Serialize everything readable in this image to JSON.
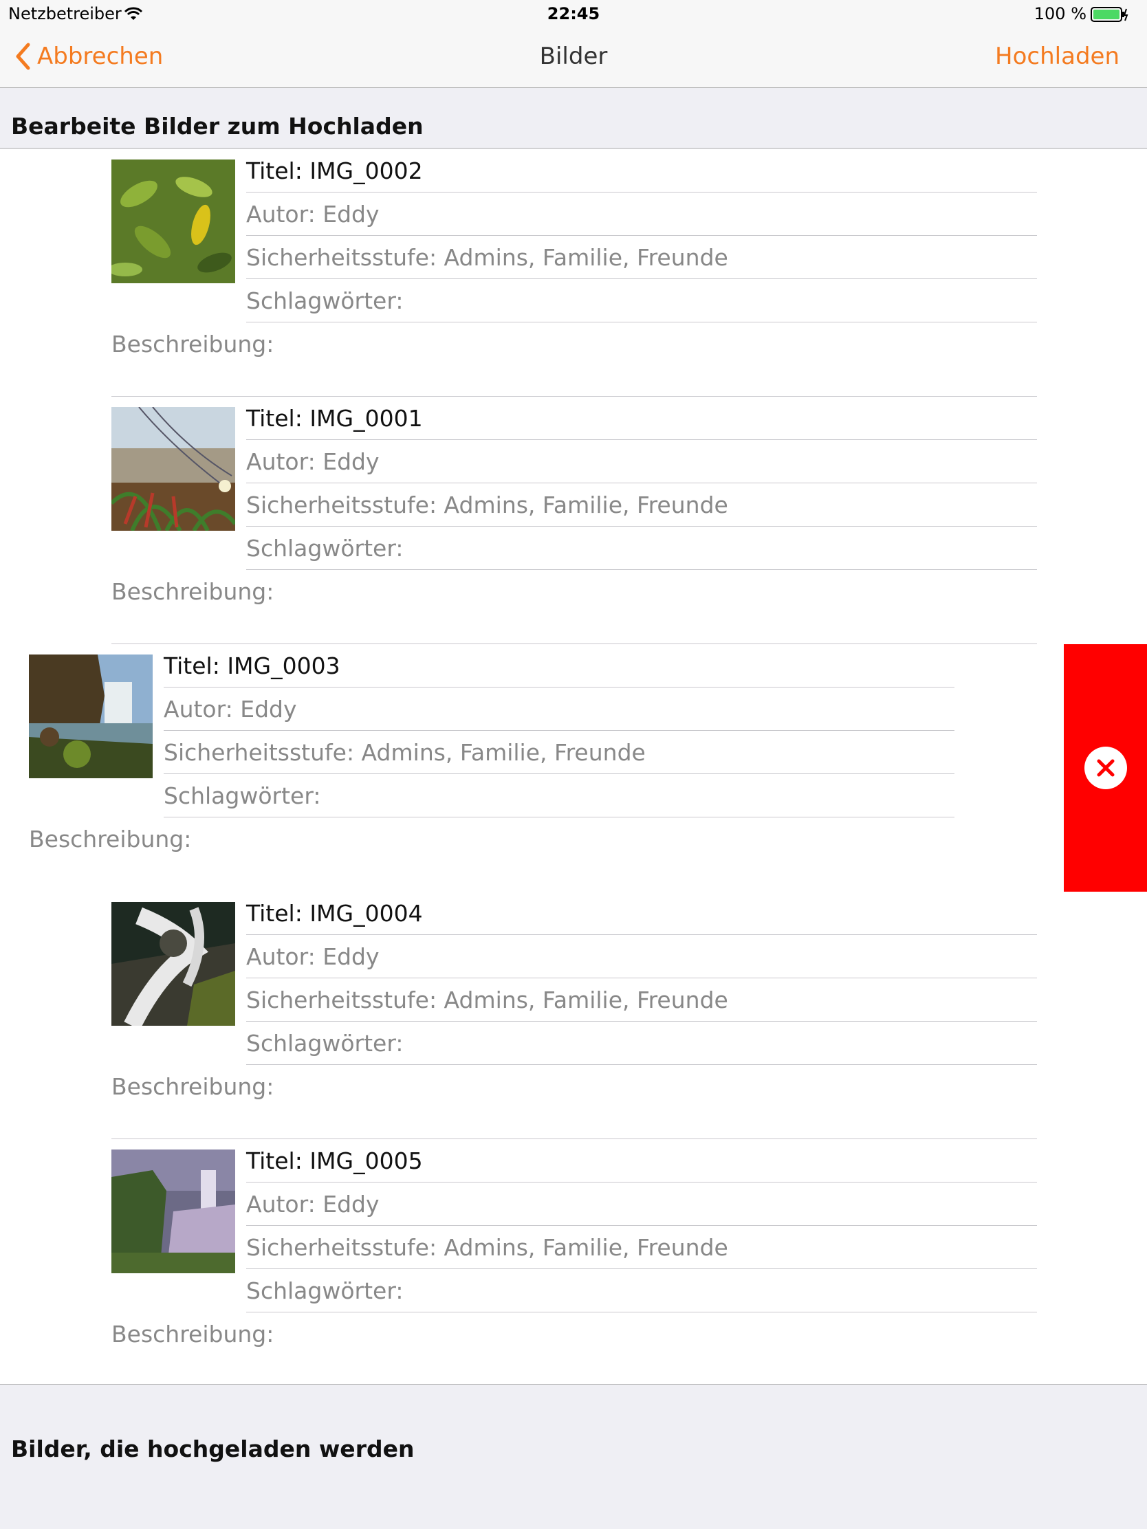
{
  "status_bar": {
    "carrier": "Netzbetreiber",
    "time": "22:45",
    "battery_percent": "100 %",
    "battery_color": "#4cd964"
  },
  "nav": {
    "back_label": "Abbrechen",
    "title": "Bilder",
    "upload_label": "Hochladen",
    "accent_color": "#f47b20"
  },
  "sections": {
    "edit_header": "Bearbeite Bilder zum Hochladen",
    "uploading_header": "Bilder, die hochgeladen werden"
  },
  "images": [
    {
      "title": "Titel: IMG_0002",
      "author": "Autor: Eddy",
      "security": "Sicherheitsstufe: Admins, Familie, Freunde",
      "tags": "Schlagwörter:",
      "description": "Beschreibung:",
      "thumb": "leaves-photo"
    },
    {
      "title": "Titel: IMG_0001",
      "author": "Autor: Eddy",
      "security": "Sicherheitsstufe: Admins, Familie, Freunde",
      "tags": "Schlagwörter:",
      "description": "Beschreibung:",
      "thumb": "grass-beach-photo"
    },
    {
      "title": "Titel: IMG_0003",
      "author": "Autor: Eddy",
      "security": "Sicherheitsstufe: Admins, Familie, Freunde",
      "tags": "Schlagwörter:",
      "description": "Beschreibung:",
      "thumb": "waterfall-cliff-photo",
      "swiped": true
    },
    {
      "title": "Titel: IMG_0004",
      "author": "Autor: Eddy",
      "security": "Sicherheitsstufe: Admins, Familie, Freunde",
      "tags": "Schlagwörter:",
      "description": "Beschreibung:",
      "thumb": "stream-rocks-photo"
    },
    {
      "title": "Titel: IMG_0005",
      "author": "Autor: Eddy",
      "security": "Sicherheitsstufe: Admins, Familie, Freunde",
      "tags": "Schlagwörter:",
      "description": "Beschreibung:",
      "thumb": "misty-waterfall-photo"
    }
  ],
  "delete_action": {
    "icon": "delete-x-icon",
    "color": "#ff0000"
  }
}
